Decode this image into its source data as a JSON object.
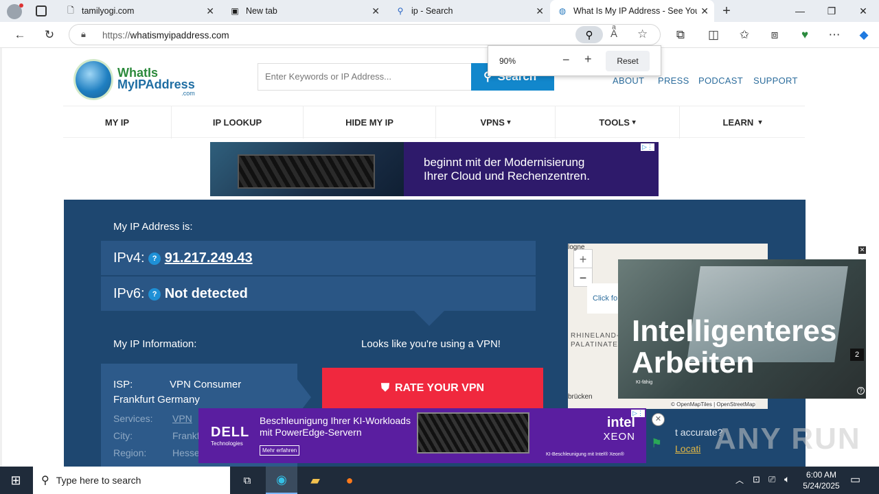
{
  "browser": {
    "tabs": [
      {
        "title": "tamilyogi.com",
        "icon": "page-icon"
      },
      {
        "title": "New tab",
        "icon": "newtab-icon"
      },
      {
        "title": "ip - Search",
        "icon": "search-icon"
      },
      {
        "title": "What Is My IP Address - See Your",
        "icon": "globe-icon"
      }
    ],
    "url_prefix": "https://",
    "url_host": "whatismyipaddress.com",
    "zoom": {
      "level": "90%",
      "reset_label": "Reset"
    }
  },
  "site": {
    "logo_line1": "WhatIs",
    "logo_line2": "MyIPAddress",
    "logo_line3": ".com",
    "search_placeholder": "Enter Keywords or IP Address...",
    "search_button": "Search",
    "top_links": [
      "ABOUT",
      "PRESS",
      "PODCAST",
      "SUPPORT"
    ],
    "nav": [
      {
        "label": "MY IP",
        "caret": ""
      },
      {
        "label": "IP LOOKUP",
        "caret": ""
      },
      {
        "label": "HIDE MY IP",
        "caret": ""
      },
      {
        "label": "VPNS",
        "caret": "▾"
      },
      {
        "label": "TOOLS",
        "caret": "▾"
      },
      {
        "label": "LEARN",
        "caret": "▾"
      }
    ]
  },
  "ad_banner": {
    "line1": "beginnt mit der Modernisierung",
    "line2": "Ihrer Cloud und Rechenzentren."
  },
  "hero": {
    "heading": "My IP Address is:",
    "ipv4_label": "IPv4:",
    "ipv4_value": "91.217.249.43",
    "ipv6_label": "IPv6:",
    "ipv6_value": "Not detected",
    "info_heading": "My IP Information:",
    "vpn_notice": "Looks like you're using a VPN!",
    "rate_button": "RATE YOUR VPN",
    "isp_label": "ISP:",
    "isp_value": "VPN Consumer",
    "isp_value2": "Frankfurt Germany",
    "services_label": "Services:",
    "services_value": "VPN",
    "city_label": "City:",
    "city_value": "Frankfurt",
    "region_label": "Region:",
    "region_value": "Hesse",
    "side_text": "t accurate?",
    "side_link": "Locati"
  },
  "map": {
    "zoom_in": "+",
    "zoom_out": "−",
    "click_hint": "Click fo",
    "region_label_1": "RHINELAND-",
    "region_label_2": "PALATINATE",
    "city_label": "brücken",
    "top_label": "logne",
    "attribution": "© OpenMapTiles | OpenStreetMap"
  },
  "video_ad": {
    "line1": "Intelligenteres",
    "line2": "Arbeiten",
    "small": "KI-fähig",
    "counter": "2"
  },
  "bottom_ad": {
    "brand": "DELL",
    "brand_sub": "Technologies",
    "line1": "Beschleunigung Ihrer KI-Workloads",
    "line2": "mit PowerEdge-Servern",
    "cta": "Mehr erfahren",
    "intel": "intel",
    "xeon": "XEON",
    "footnote": "KI-Beschleunigung mit Intel® Xeon®"
  },
  "watermark": "ANY RUN",
  "taskbar": {
    "search_placeholder": "Type here to search",
    "time": "6:00 AM",
    "date": "5/24/2025"
  }
}
